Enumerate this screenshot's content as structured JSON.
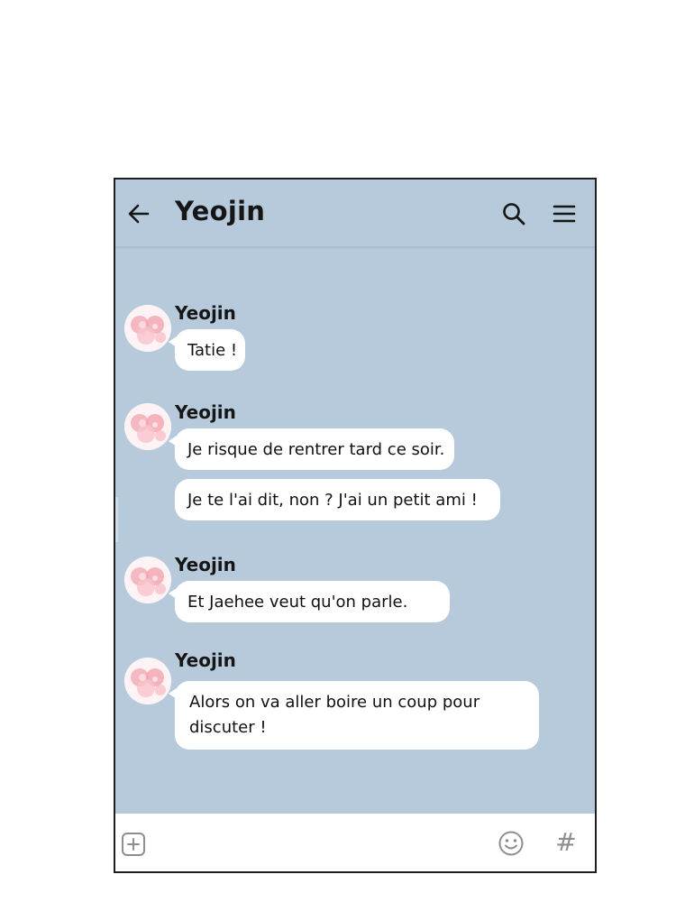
{
  "header": {
    "title": "Yeojin",
    "back_icon": "arrow-left-icon",
    "search_icon": "search-icon",
    "menu_icon": "hamburger-menu-icon"
  },
  "messages": [
    {
      "sender": "Yeojin",
      "bubbles": [
        "Tatie !"
      ]
    },
    {
      "sender": "Yeojin",
      "bubbles": [
        "Je risque de rentrer tard ce soir.",
        "Je te l'ai dit, non ? J'ai un petit ami !"
      ]
    },
    {
      "sender": "Yeojin",
      "bubbles": [
        "Et Jaehee veut qu'on parle."
      ]
    },
    {
      "sender": "Yeojin",
      "bubbles": [
        "Alors on va aller boire un coup pour discuter !"
      ]
    }
  ],
  "input_bar": {
    "plus_icon": "plus-box-icon",
    "emoji_icon": "smiley-icon",
    "hash_label": "#"
  },
  "colors": {
    "chat_background": "#b6cadc",
    "bubble": "#ffffff",
    "text": "#161616"
  }
}
